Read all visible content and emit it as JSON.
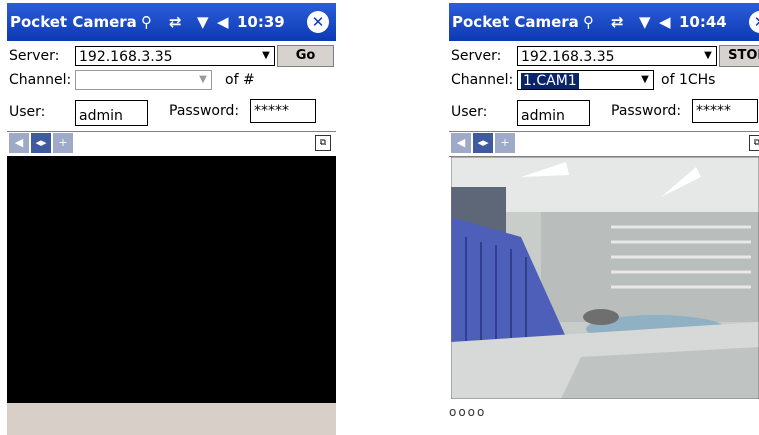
{
  "left_screen": {
    "title": "Pocket Camera",
    "time": "10:39",
    "server_label": "Server:",
    "server_value": "192.168.3.35",
    "go_label": "Go",
    "channel_label": "Channel:",
    "channel_value": "",
    "channel_count": "of #",
    "user_label": "User:",
    "user_value": "admin",
    "password_label": "Password:",
    "password_value": "*****"
  },
  "right_screen": {
    "title": "Pocket Camera",
    "time": "10:44",
    "server_label": "Server:",
    "server_value": "192.168.3.35",
    "stop_label": "STOP",
    "channel_label": "Channel:",
    "channel_value": "1.CAM1",
    "channel_count": "of 1CHs",
    "user_label": "User:",
    "user_value": "admin",
    "password_label": "Password:",
    "password_value": "*****",
    "status_dots": "oooo"
  },
  "icons": {
    "connectivity": "connectivity-icon",
    "sync": "sync-icon",
    "signal": "signal-icon",
    "volume": "volume-icon",
    "close": "close-icon",
    "prev": "chevron-left-icon",
    "pan": "pan-icon",
    "next": "plus-icon",
    "fullscreen": "fullscreen-icon"
  },
  "colors": {
    "titlebar": "#1b4fcf",
    "selection": "#0a246a",
    "video_off": "#000000",
    "bottom_bar": "#d8d0c8"
  }
}
